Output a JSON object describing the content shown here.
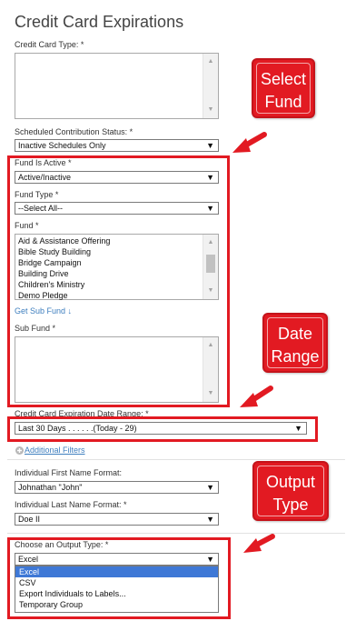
{
  "page": {
    "title": "Credit Card Expirations"
  },
  "credit_card_type": {
    "label": "Credit Card Type: *",
    "options": []
  },
  "scheduled_status": {
    "label": "Scheduled Contribution Status: *",
    "value": "Inactive Schedules Only"
  },
  "fund_is_active": {
    "label": "Fund Is Active *",
    "value": "Active/Inactive"
  },
  "fund_type": {
    "label": "Fund Type *",
    "value": "--Select All--"
  },
  "fund": {
    "label": "Fund *",
    "options": [
      "Aid & Assistance Offering",
      "Bible Study Building",
      "Bridge Campaign",
      "Building Drive",
      "Children's Ministry",
      "Demo Pledge"
    ]
  },
  "get_sub_fund": {
    "label": "Get Sub Fund ↓"
  },
  "sub_fund": {
    "label": "Sub Fund *"
  },
  "date_range": {
    "label": "Credit Card Expiration Date Range: *",
    "value": "Last 30 Days . . . . . .(Today - 29)"
  },
  "additional_filters": {
    "label": "Additional Filters"
  },
  "first_name_format": {
    "label": "Individual First Name Format:",
    "value": "Johnathan \"John\""
  },
  "last_name_format": {
    "label": "Individual Last Name Format: *",
    "value": "Doe II"
  },
  "output_type": {
    "label": "Choose an Output Type: *",
    "value": "Excel",
    "options": [
      "Excel",
      "CSV",
      "Export Individuals to Labels...",
      "Temporary Group"
    ]
  },
  "callouts": {
    "select_fund": [
      "Select",
      "Fund"
    ],
    "date_range": [
      "Date",
      "Range"
    ],
    "output_type": [
      "Output",
      "Type"
    ]
  },
  "colors": {
    "annotation_red": "#e21a22",
    "link_blue": "#3f7fbf",
    "selected_blue": "#3e78d6"
  },
  "icons": {
    "dropdown": "▼",
    "scroll_up": "▲",
    "scroll_down": "▼",
    "filters_toggle": "circle-plus-icon"
  }
}
